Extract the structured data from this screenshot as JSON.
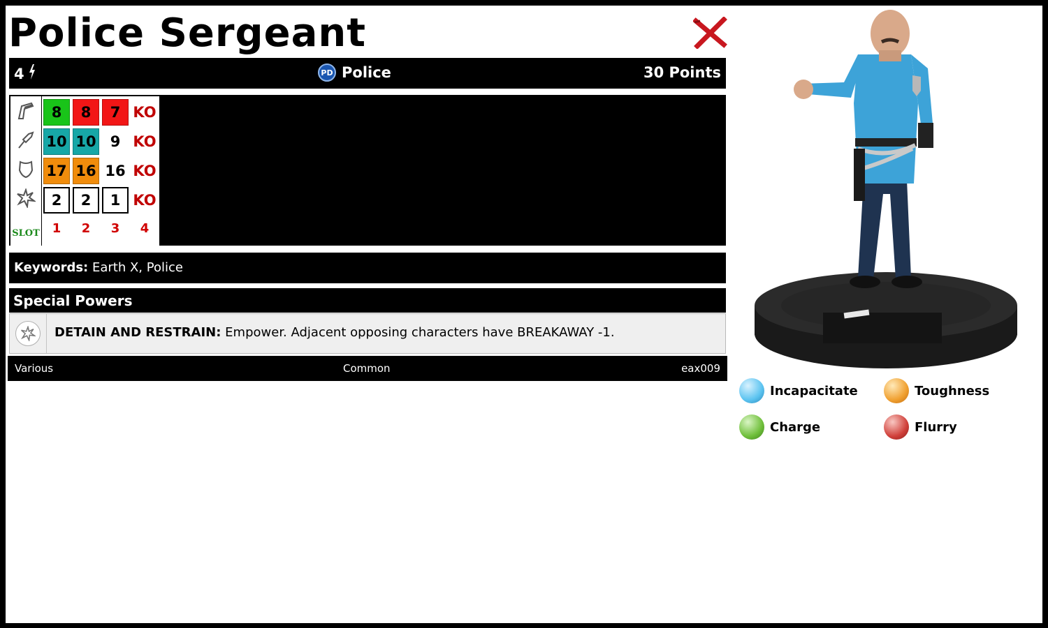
{
  "character": {
    "name": "Police Sergeant",
    "speed": "4",
    "team": "Police",
    "team_logo_text": "PD",
    "points": "30 Points"
  },
  "dial": {
    "rows": [
      {
        "stat": "speed",
        "icon": "boot-speed-icon",
        "cells": [
          {
            "value": "8",
            "color": "#19c419",
            "boxed": true
          },
          {
            "value": "8",
            "color": "#f21616",
            "boxed": true
          },
          {
            "value": "7",
            "color": "#f21616",
            "boxed": true
          },
          {
            "value": "KO",
            "ko": true
          }
        ]
      },
      {
        "stat": "attack",
        "icon": "fist-attack-icon",
        "cells": [
          {
            "value": "10",
            "color": "#17a7a7",
            "boxed": true
          },
          {
            "value": "10",
            "color": "#17a7a7",
            "boxed": true
          },
          {
            "value": "9",
            "color": "#ffffff",
            "plain": true
          },
          {
            "value": "KO",
            "ko": true
          }
        ]
      },
      {
        "stat": "defense",
        "icon": "shield-defense-icon",
        "cells": [
          {
            "value": "17",
            "color": "#f08c0c",
            "boxed": true
          },
          {
            "value": "16",
            "color": "#f08c0c",
            "boxed": true
          },
          {
            "value": "16",
            "color": "#ffffff",
            "plain": true
          },
          {
            "value": "KO",
            "ko": true
          }
        ]
      },
      {
        "stat": "damage",
        "icon": "burst-damage-icon",
        "cells": [
          {
            "value": "2",
            "color": "#ffffff",
            "boxed": true
          },
          {
            "value": "2",
            "color": "#ffffff",
            "boxed": true
          },
          {
            "value": "1",
            "color": "#ffffff",
            "boxed": true
          },
          {
            "value": "KO",
            "ko": true
          }
        ]
      }
    ],
    "slot_label": "SLOT",
    "clicks": [
      "1",
      "2",
      "3",
      "4"
    ]
  },
  "keywords": {
    "label": "Keywords:",
    "value": "Earth X, Police"
  },
  "special_powers": {
    "header": "Special Powers",
    "powers": [
      {
        "name": "DETAIN AND RESTRAIN:",
        "text": "Empower. Adjacent opposing characters have BREAKAWAY -1.",
        "icon": "burst-damage-icon"
      }
    ]
  },
  "footer": {
    "artist": "Various",
    "rarity": "Common",
    "set_id": "eax009"
  },
  "legend": [
    {
      "label": "Incapacitate",
      "color": "#5bc3f0",
      "icon": "incapacitate-icon"
    },
    {
      "label": "Toughness",
      "color": "#f0a030",
      "icon": "toughness-icon"
    },
    {
      "label": "Charge",
      "color": "#6fbf3a",
      "icon": "charge-icon"
    },
    {
      "label": "Flurry",
      "color": "#d0403a",
      "icon": "flurry-icon"
    }
  ]
}
